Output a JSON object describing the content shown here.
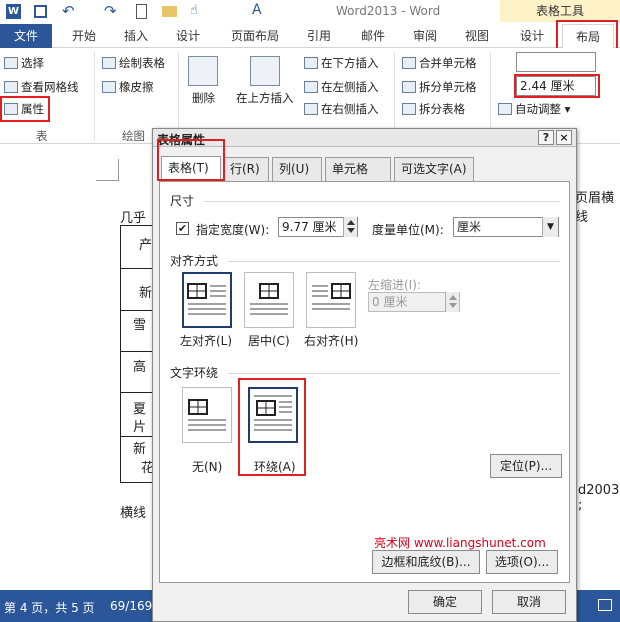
{
  "titlebar": {
    "app_title": "Word2013 - Word",
    "context_header": "表格工具"
  },
  "tabs": [
    "文件",
    "开始",
    "插入",
    "设计",
    "页面布局",
    "引用",
    "邮件",
    "审阅",
    "视图",
    "设计",
    "布局"
  ],
  "ribbon": {
    "table_group": {
      "select": "选择",
      "view_gridlines": "查看网格线",
      "properties": "属性",
      "group_label": "表"
    },
    "draw_group": {
      "draw_table": "绘制表格",
      "eraser": "橡皮擦",
      "group_label": "绘图"
    },
    "delete": "删除",
    "insert_above": "在上方插入",
    "insert_below": "在下方插入",
    "insert_left": "在左侧插入",
    "insert_right": "在右侧插入",
    "merge_cells": "合并单元格",
    "split_cells": "拆分单元格",
    "split_table": "拆分表格",
    "height_value": "",
    "width_value": "2.44 厘米",
    "autofit": "自动调整"
  },
  "document": {
    "frag_right1": "页眉横线",
    "frag_line1": "几乎",
    "frag_cells": [
      "产",
      "新",
      "雪",
      "高",
      "夏",
      "片",
      "新",
      "花"
    ],
    "frag_right2": "d2003 ;",
    "frag_line2": "横线"
  },
  "dialog": {
    "title": "表格属性",
    "help": "?",
    "close": "×",
    "tabs": [
      "表格(T)",
      "行(R)",
      "列(U)",
      "单元格(E)",
      "可选文字(A)"
    ],
    "size_section": "尺寸",
    "preferred_width_label": "指定宽度(W):",
    "preferred_width_value": "9.77 厘米",
    "measure_label": "度量单位(M):",
    "measure_value": "厘米",
    "alignment_section": "对齐方式",
    "align_left": "左对齐(L)",
    "align_center": "居中(C)",
    "align_right": "右对齐(H)",
    "indent_label": "左缩进(I):",
    "indent_value": "0 厘米",
    "wrap_section": "文字环绕",
    "wrap_none": "无(N)",
    "wrap_around": "环绕(A)",
    "positioning": "定位(P)...",
    "watermark": "亮术网 www.liangshunet.com",
    "borders_shading": "边框和底纹(B)...",
    "options": "选项(O)...",
    "ok": "确定",
    "cancel": "取消",
    "preferred_width_checked": true
  },
  "status": {
    "page": "第 4 页，共 5 页",
    "words": "69/169"
  },
  "colors": {
    "accent": "#2b579a",
    "highlight": "#e02020",
    "context": "#fdf2c8",
    "watermark": "#d8001a"
  }
}
